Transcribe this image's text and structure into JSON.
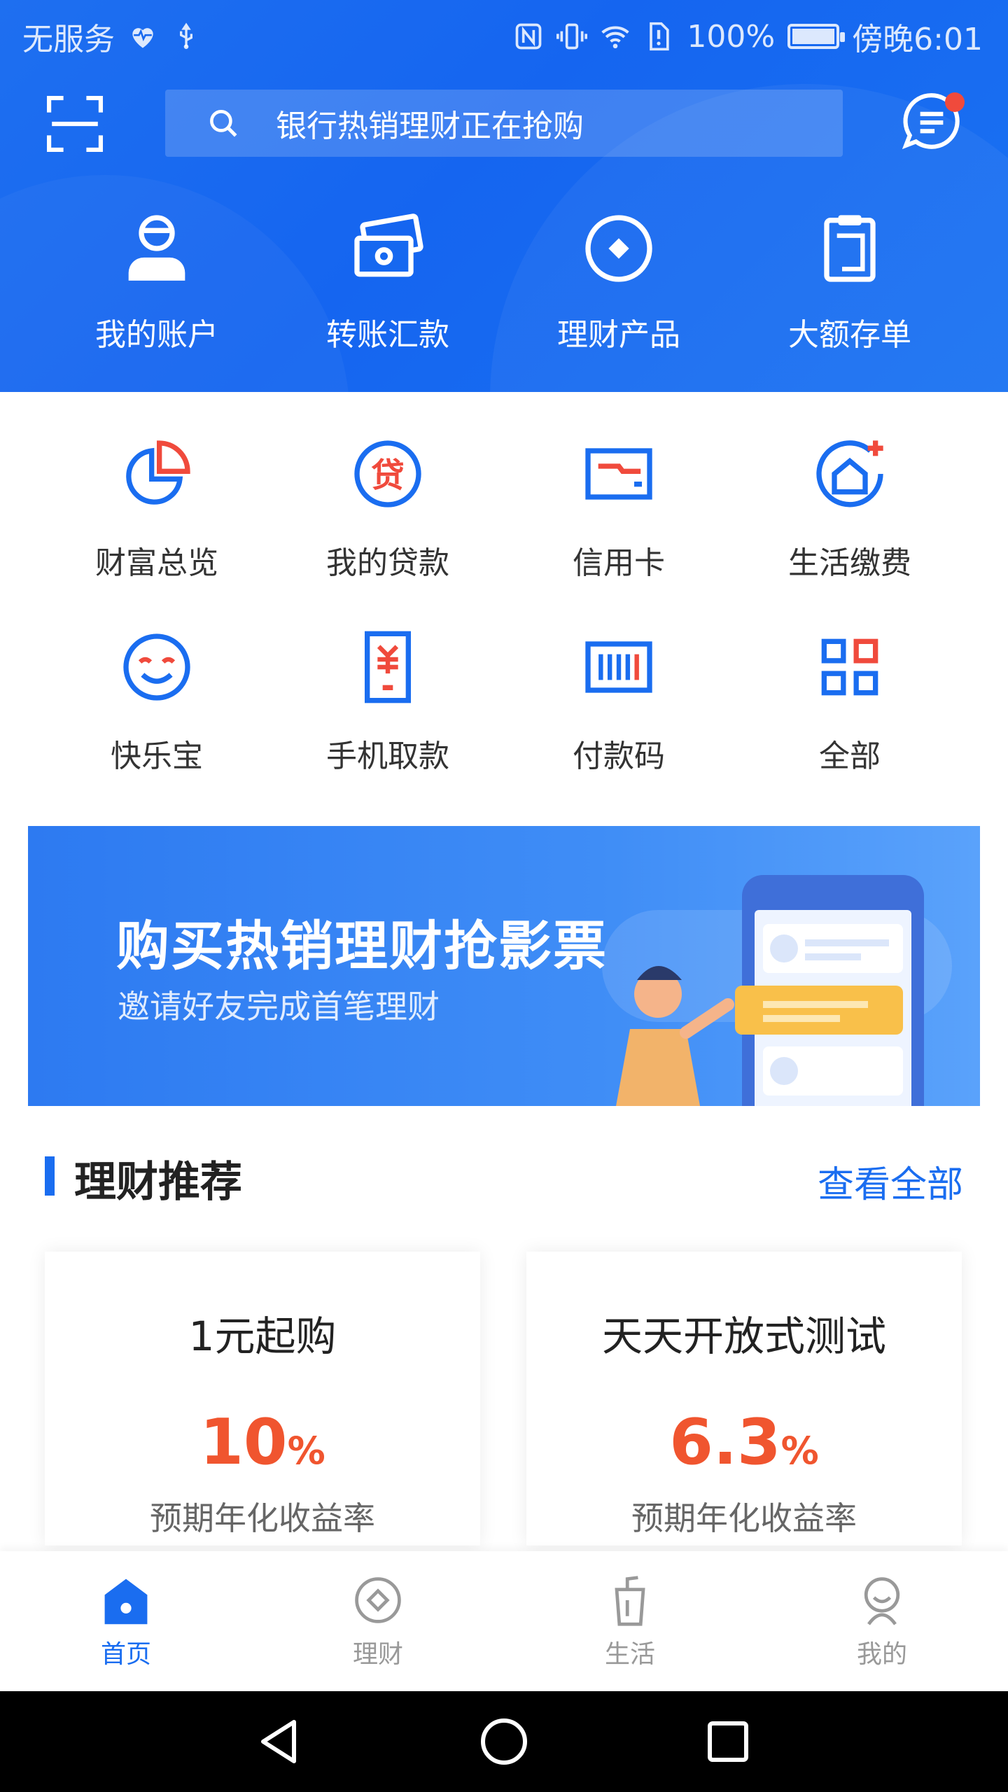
{
  "status_bar": {
    "carrier": "无服务",
    "battery": "100%",
    "time": "傍晚6:01"
  },
  "search": {
    "placeholder": "银行热销理财正在抢购"
  },
  "quick_actions": [
    {
      "label": "我的账户",
      "icon": "user-icon"
    },
    {
      "label": "转账汇款",
      "icon": "transfer-icon"
    },
    {
      "label": "理财产品",
      "icon": "diamond-icon"
    },
    {
      "label": "大额存单",
      "icon": "certificate-icon"
    }
  ],
  "grid": [
    {
      "label": "财富总览",
      "icon": "pie-chart-icon"
    },
    {
      "label": "我的贷款",
      "icon": "loan-icon"
    },
    {
      "label": "信用卡",
      "icon": "credit-card-icon"
    },
    {
      "label": "生活缴费",
      "icon": "home-plus-icon"
    },
    {
      "label": "快乐宝",
      "icon": "smile-icon"
    },
    {
      "label": "手机取款",
      "icon": "phone-withdraw-icon"
    },
    {
      "label": "付款码",
      "icon": "barcode-icon"
    },
    {
      "label": "全部",
      "icon": "grid-icon"
    }
  ],
  "banner": {
    "title": "购买热销理财抢影票",
    "subtitle": "邀请好友完成首笔理财"
  },
  "section": {
    "title": "理财推荐",
    "more": "查看全部"
  },
  "products": [
    {
      "name": "1元起购",
      "rate": "10",
      "unit": "%",
      "rate_label": "预期年化收益率"
    },
    {
      "name": "天天开放式测试",
      "rate": "6.3",
      "unit": "%",
      "rate_label": "预期年化收益率"
    }
  ],
  "tabs": [
    {
      "label": "首页",
      "icon": "home-icon",
      "active": true
    },
    {
      "label": "理财",
      "icon": "wealth-icon",
      "active": false
    },
    {
      "label": "生活",
      "icon": "life-icon",
      "active": false
    },
    {
      "label": "我的",
      "icon": "profile-icon",
      "active": false
    }
  ],
  "colors": {
    "brand": "#1a6df0",
    "accent": "#f0552f",
    "icon_red": "#f04a3c"
  }
}
